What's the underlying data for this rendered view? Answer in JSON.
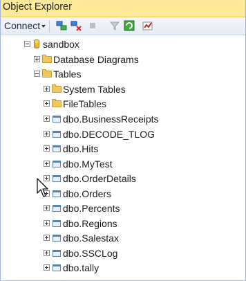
{
  "panel": {
    "title": "Object Explorer"
  },
  "toolbar": {
    "connect_label": "Connect",
    "dropdown_icon": "chevron-down-icon"
  },
  "tree": {
    "root": "sandbox",
    "folders": {
      "diagrams": "Database Diagrams",
      "tables": "Tables"
    },
    "table_children": [
      "System Tables",
      "FileTables",
      "dbo.BusinessReceipts",
      "dbo.DECODE_TLOG",
      "dbo.Hits",
      "dbo.MyTest",
      "dbo.OrderDetails",
      "dbo.Orders",
      "dbo.Percents",
      "dbo.Regions",
      "dbo.Salestax",
      "dbo.SSCLog",
      "dbo.tally"
    ]
  },
  "colors": {
    "title_bg": "#ffe99a",
    "toolbar_bg": "#e9eef6",
    "folder": "#f0c760",
    "table_icon": "#5a7fb4"
  }
}
